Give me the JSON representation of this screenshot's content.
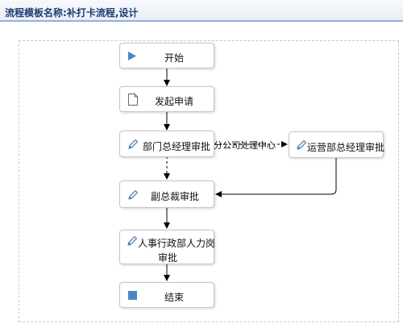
{
  "header": {
    "title_prefix": "流程模板名称:",
    "title_value": "补打卡流程,设计"
  },
  "nodes": {
    "start": {
      "label": "开始",
      "icon": "play-icon",
      "color": "#4a86c5"
    },
    "initiate": {
      "label": "发起申请",
      "icon": "document-icon"
    },
    "dept_manager": {
      "label": "部门总经理审批",
      "icon": "pencil-icon"
    },
    "ops_manager": {
      "label": "运营部总经理审批",
      "icon": "pencil-icon"
    },
    "vice_president": {
      "label": "副总裁审批",
      "icon": "pencil-icon"
    },
    "hr_approval": {
      "label_line1": "人事行政部人力岗",
      "label_line2": "审批",
      "icon": "pencil-icon"
    },
    "end": {
      "label": "结束",
      "icon": "stop-icon",
      "color": "#4a86c5"
    }
  },
  "edges": {
    "branch_label": "分公司处理中心"
  }
}
